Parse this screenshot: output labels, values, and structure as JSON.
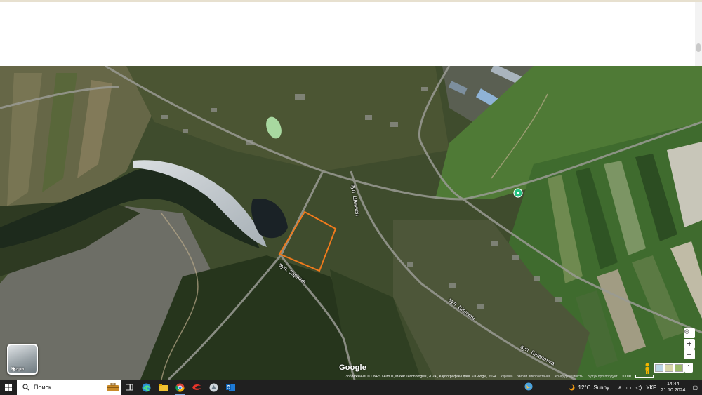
{
  "map": {
    "road_labels": [
      "вул. Шевчен",
      "вул. Заріччя",
      "вул. Шевчен",
      "вул. Шевченка"
    ],
    "layers_label": "Шари",
    "logo": "Google",
    "attribution": {
      "imagery": "Зображення: © CNES / Airbus, Maxar Technologies, 2024., Картографічні дані: © Google, 2024",
      "country": "Україна",
      "terms": "Умови використання",
      "privacy": "Конфіденційність",
      "feedback": "Відгук про продукт",
      "scale": "100 м"
    },
    "controls": {
      "locate_icon": "my-location-icon",
      "zoom_in": "+",
      "zoom_out": "−",
      "pegman_icon": "pegman-icon",
      "toggle_icon": "chevron-up-icon"
    },
    "parcel_outline_color": "#f07a1c",
    "marker_color": "#26c281"
  },
  "taskbar": {
    "search_placeholder": "Поиск",
    "apps": [
      "briefcase-icon",
      "task-view-icon",
      "edge-icon",
      "file-explorer-icon",
      "chrome-icon",
      "red-app-icon",
      "app-icon",
      "outlook-icon"
    ],
    "weather": {
      "temp": "12°C",
      "condition": "Sunny"
    },
    "language": "УКР",
    "time": "14:44",
    "date": "21.10.2024"
  }
}
